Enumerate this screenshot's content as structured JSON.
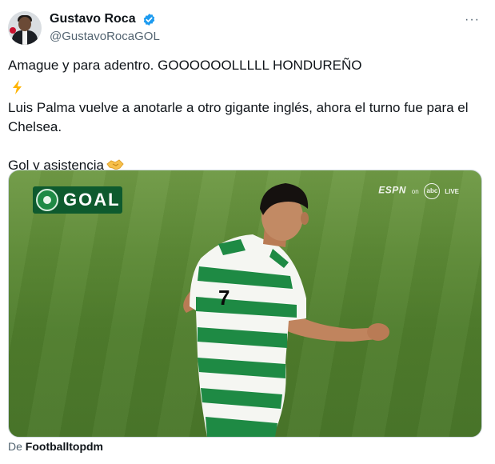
{
  "author": {
    "display_name": "Gustavo Roca",
    "handle": "@GustavoRocaGOL",
    "verified": true
  },
  "menu": {
    "more_label": "···"
  },
  "tweet": {
    "line1": "Amague y para adentro. GOOOOOOLLLLL HONDUREÑO",
    "line2": "Luis Palma vuelve a anotarle a otro gigante inglés, ahora el turno fue para el Chelsea.",
    "line3": "Gol y asistencia"
  },
  "media": {
    "overlay_badge": "GOAL",
    "broadcaster": "ESPN",
    "broadcaster_on": "on",
    "network": "abc",
    "live_label": "LIVE",
    "player_number": "7"
  },
  "source": {
    "prefix": "De",
    "name": "Footballtopdm"
  },
  "colors": {
    "verified_blue": "#1d9bf0",
    "text_primary": "#0f1419",
    "text_secondary": "#536471",
    "celtic_green": "#1e8a44",
    "honduras_blue": "#0073cf"
  },
  "icons": [
    "verified-badge-icon",
    "more-icon",
    "honduras-flag-icon",
    "lightning-icon",
    "handshake-icon",
    "celtic-clover-icon"
  ]
}
